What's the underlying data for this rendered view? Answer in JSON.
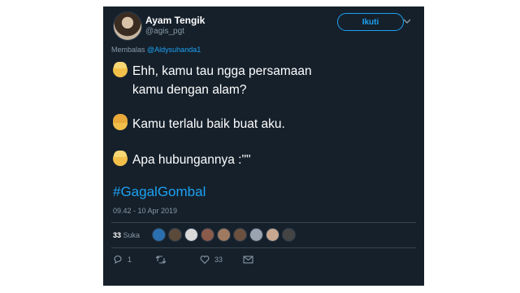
{
  "tweet": {
    "author_name": "Ayam Tengik",
    "author_handle": "@agis_pgt",
    "follow_label": "Ikuti",
    "reply_prefix": "Membalas",
    "reply_mention": "@Aldysuhanda1",
    "lines": [
      "Ehh, kamu tau ngga persamaan",
      "kamu dengan alam?",
      "Kamu terlalu baik buat aku.",
      "Apa hubungannya :\"\""
    ],
    "hashtag": "#GagalGombal",
    "timestamp": "09.42 - 10 Apr 2019",
    "likes_count": "33",
    "likes_label": "Suka",
    "reply_count": "1",
    "like_count_action": "33"
  },
  "liker_colors": [
    "#2a6fb0",
    "#5b4a3a",
    "#d9d9d9",
    "#8a5a4a",
    "#a07a60",
    "#6b5040",
    "#9aa4b0",
    "#c8a890",
    "#444"
  ],
  "colors": {
    "background": "#15202b",
    "accent": "#1da1f2",
    "muted": "#8899a6"
  },
  "icons": [
    "chevron-down-icon",
    "reply-icon",
    "retweet-icon",
    "heart-icon",
    "message-icon"
  ]
}
